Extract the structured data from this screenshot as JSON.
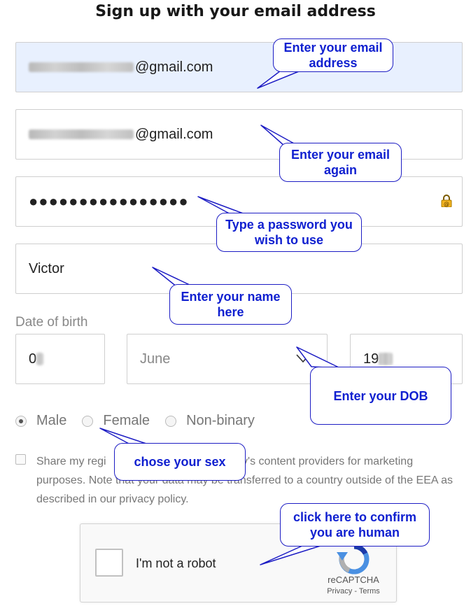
{
  "form": {
    "title": "Sign up with your email address",
    "email": {
      "domain_suffix": "@gmail.com"
    },
    "confirm_email": {
      "domain_suffix": "@gmail.com"
    },
    "password": {
      "masked_value": "●●●●●●●●●●●●●●●●",
      "lock_icon": "lock-icon"
    },
    "name": {
      "value": "Victor"
    },
    "dob": {
      "label": "Date of birth",
      "day_prefix": "0",
      "month": "June",
      "year_prefix": "19"
    },
    "gender": {
      "options": [
        "Male",
        "Female",
        "Non-binary"
      ],
      "selected": "Male"
    },
    "share": {
      "text_part1": "Share my regi",
      "text_part2": "fy's content providers for marketing purposes. Note that your data may be transferred to a country outside of the EEA as described in our privacy policy."
    },
    "recaptcha": {
      "label": "I'm not a robot",
      "brand": "reCAPTCHA",
      "links": "Privacy - Terms"
    }
  },
  "callouts": {
    "email": "Enter your email address",
    "confirm_email": "Enter your email again",
    "password": "Type a password you wish to use",
    "name": "Enter your name here",
    "dob": "Enter your DOB",
    "gender": "chose your sex",
    "captcha": "click here to confirm you are human"
  },
  "colors": {
    "callout_text": "#1020d0",
    "callout_border": "#1d1dc4",
    "autofill_bg": "#e8f0fe"
  }
}
